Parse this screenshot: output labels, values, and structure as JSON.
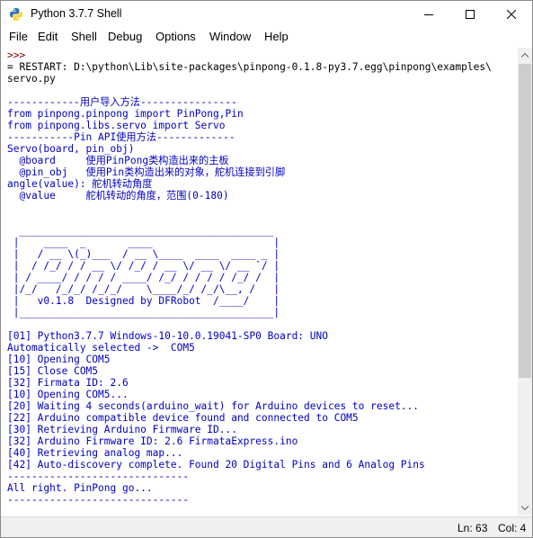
{
  "window": {
    "title": "Python 3.7.7 Shell"
  },
  "menubar": {
    "items": [
      "File",
      "Edit",
      "Shell",
      "Debug",
      "Options",
      "Window",
      "Help"
    ]
  },
  "shell": {
    "lines": [
      {
        "text": ">>> ",
        "kind": "prompt"
      },
      {
        "text": "= RESTART: D:\\python\\Lib\\site-packages\\pinpong-0.1.8-py3.7.egg\\pinpong\\examples\\",
        "kind": "sys"
      },
      {
        "text": "servo.py",
        "kind": "sys"
      },
      {
        "text": "",
        "kind": "out"
      },
      {
        "text": "------------用户导入方法----------------",
        "kind": "out"
      },
      {
        "text": "from pinpong.pinpong import PinPong,Pin",
        "kind": "out"
      },
      {
        "text": "from pinpong.libs.servo import Servo",
        "kind": "out"
      },
      {
        "text": "-----------Pin API使用方法-------------",
        "kind": "out"
      },
      {
        "text": "Servo(board, pin_obj)",
        "kind": "out"
      },
      {
        "text": "  @board     使用PinPong类构造出来的主板",
        "kind": "out"
      },
      {
        "text": "  @pin_obj   使用Pin类构造出来的对象，舵机连接到引脚",
        "kind": "out"
      },
      {
        "text": "angle(value): 舵机转动角度",
        "kind": "out"
      },
      {
        "text": "  @value     舵机转动的角度，范围(0-180)",
        "kind": "out"
      },
      {
        "text": "",
        "kind": "out"
      },
      {
        "text": "",
        "kind": "out"
      },
      {
        "text": "  __________________________________________",
        "kind": "out"
      },
      {
        "text": " |    ____  _       ____                    |",
        "kind": "out"
      },
      {
        "text": " |   / __ \\(_)___  / __ \\____  ____  ____ _ |",
        "kind": "out"
      },
      {
        "text": " |  / /_/ / / __ \\/ /_/ / __ \\/ __ \\/ __ `/ |",
        "kind": "out"
      },
      {
        "text": " | / ____/ / / / / ____/ /_/ / / / / /_/ /  |",
        "kind": "out"
      },
      {
        "text": " |/_/   /_/_/ /_/_/    \\____/_/ /_/\\__, /   |",
        "kind": "out"
      },
      {
        "text": " |   v0.1.8  Designed by DFRobot  /____/    |",
        "kind": "out"
      },
      {
        "text": " |__________________________________________|",
        "kind": "out"
      },
      {
        "text": "",
        "kind": "out"
      },
      {
        "text": "[01] Python3.7.7 Windows-10-10.0.19041-SP0 Board: UNO",
        "kind": "out"
      },
      {
        "text": "Automatically selected ->  COM5",
        "kind": "out"
      },
      {
        "text": "[10] Opening COM5",
        "kind": "out"
      },
      {
        "text": "[15] Close COM5",
        "kind": "out"
      },
      {
        "text": "[32] Firmata ID: 2.6",
        "kind": "out"
      },
      {
        "text": "[10] Opening COM5...",
        "kind": "out"
      },
      {
        "text": "[20] Waiting 4 seconds(arduino_wait) for Arduino devices to reset...",
        "kind": "out"
      },
      {
        "text": "[22] Arduino compatible device found and connected to COM5",
        "kind": "out"
      },
      {
        "text": "[30] Retrieving Arduino Firmware ID...",
        "kind": "out"
      },
      {
        "text": "[32] Arduino Firmware ID: 2.6 FirmataExpress.ino",
        "kind": "out"
      },
      {
        "text": "[40] Retrieving analog map...",
        "kind": "out"
      },
      {
        "text": "[42] Auto-discovery complete. Found 20 Digital Pins and 6 Analog Pins",
        "kind": "out"
      },
      {
        "text": "------------------------------",
        "kind": "out"
      },
      {
        "text": "All right. PinPong go...",
        "kind": "out"
      },
      {
        "text": "------------------------------",
        "kind": "out"
      }
    ]
  },
  "statusbar": {
    "line": "Ln: 63",
    "col": "Col: 4"
  },
  "colors": {
    "output": "#0000c0",
    "prompt": "#7f0000",
    "system": "#000000"
  },
  "icons": {
    "app": "python-icon",
    "minimize": "minimize-icon",
    "maximize": "maximize-icon",
    "close": "close-icon"
  }
}
